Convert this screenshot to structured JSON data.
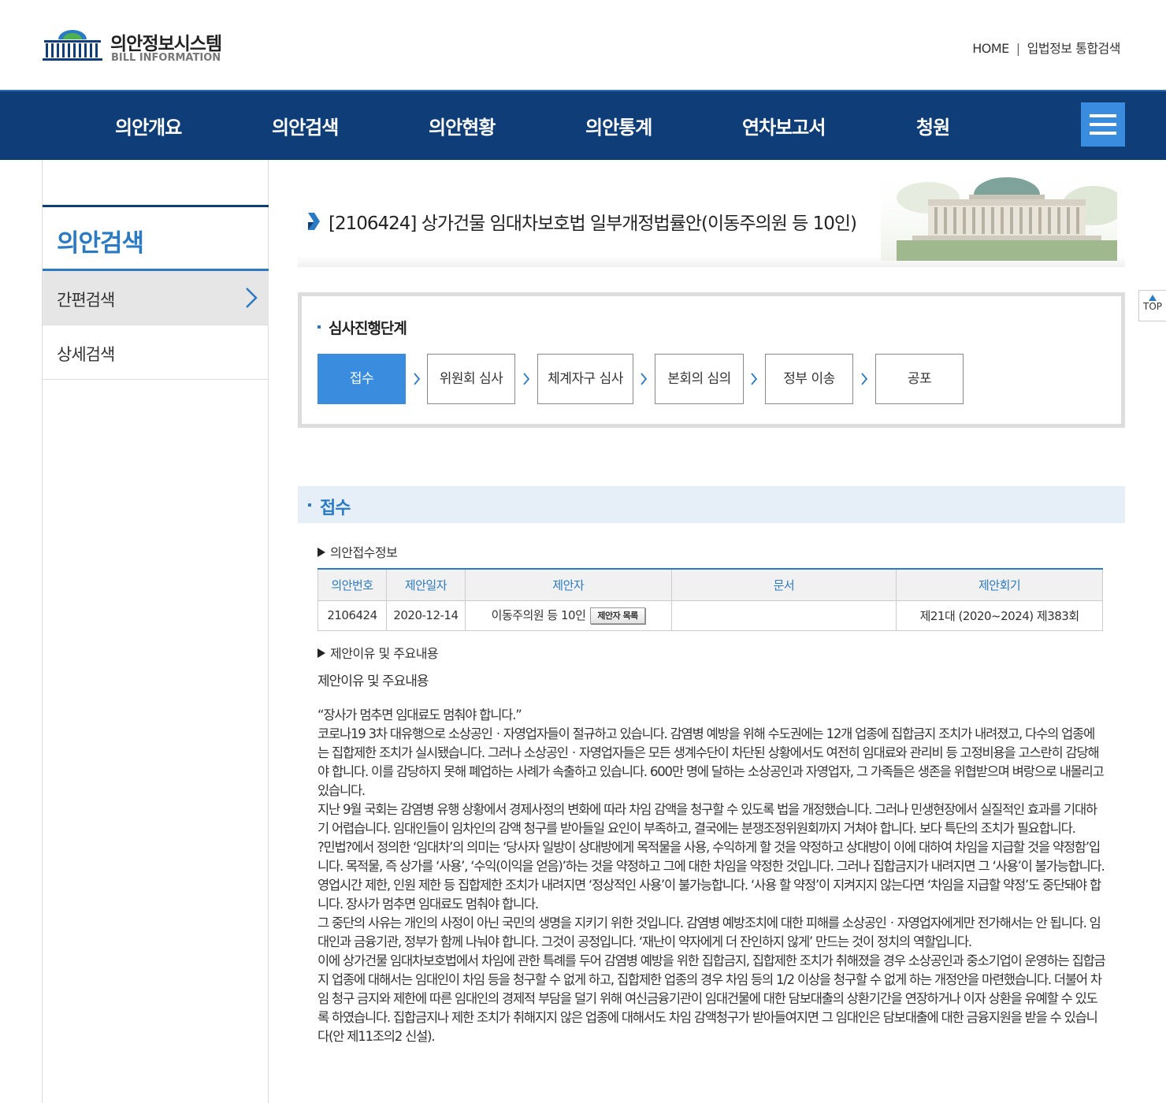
{
  "header": {
    "logo_title": "의안정보시스템",
    "logo_sub": "BILL INFORMATION",
    "util_home": "HOME",
    "util_sep": "|",
    "util_search": "입법정보 통합검색"
  },
  "gnb": [
    "의안개요",
    "의안검색",
    "의안현황",
    "의안통계",
    "연차보고서",
    "청원"
  ],
  "sidebar": {
    "title": "의안검색",
    "items": [
      {
        "label": "간편검색"
      },
      {
        "label": "상세검색"
      }
    ]
  },
  "page": {
    "title": "[2106424] 상가건물 임대차보호법 일부개정법률안(이동주의원 등 10인)",
    "top_label": "TOP"
  },
  "steps": {
    "title": "심사진행단계",
    "items": [
      "접수",
      "위원회 심사",
      "체계자구 심사",
      "본회의 심의",
      "정부 이송",
      "공포"
    ]
  },
  "section": {
    "title": "접수",
    "info_head": "의안접수정보",
    "columns": [
      "의안번호",
      "제안일자",
      "제안자",
      "문서",
      "제안회기"
    ],
    "row": {
      "bill_no": "2106424",
      "date": "2020-12-14",
      "proposer": "이동주의원 등 10인",
      "proposer_btn": "제안자 목록",
      "doc": "",
      "session": "제21대 (2020~2024) 제383회"
    },
    "reason_head": "제안이유 및 주요내용",
    "reason_label": "제안이유 및 주요내용",
    "reason_lines": [
      "“장사가 멈추면 임대료도 멈춰야 합니다.”",
      "코로나19 3차 대유행으로 소상공인ㆍ자영업자들이 절규하고 있습니다. 감염병 예방을 위해 수도권에는 12개 업종에 집합금지 조치가 내려졌고, 다수의 업종에는 집합제한 조치가 실시됐습니다. 그러나 소상공인ㆍ자영업자들은 모든 생계수단이 차단된 상황에서도 여전히 임대료와 관리비 등 고정비용을 고스란히 감당해야 합니다. 이를 감당하지 못해 폐업하는 사례가 속출하고 있습니다. 600만 명에 달하는 소상공인과 자영업자, 그 가족들은 생존을 위협받으며 벼랑으로 내몰리고 있습니다.",
      "지난 9월 국회는 감염병 유행 상황에서 경제사정의 변화에 따라 차임 감액을 청구할 수 있도록 법을 개정했습니다. 그러나 민생현장에서 실질적인 효과를 기대하기 어렵습니다. 임대인들이 임차인의 감액 청구를 받아들일 요인이 부족하고, 결국에는 분쟁조정위원회까지 거쳐야 합니다. 보다 특단의 조치가 필요합니다.",
      "?민법?에서 정의한 ‘임대차’의 의미는 ‘당사자 일방이 상대방에게 목적물을 사용, 수익하게 할 것을 약정하고 상대방이 이에 대하여 차임을 지급할 것을 약정함’입니다. 목적물, 즉 상가를 ‘사용’, ‘수익(이익을 얻음)’하는 것을 약정하고 그에 대한 차임을 약정한 것입니다. 그러나 집합금지가 내려지면 그 ‘사용’이 불가능합니다. 영업시간 제한, 인원 제한 등 집합제한 조치가 내려지면 ‘정상적인 사용’이 불가능합니다. ‘사용 할 약정’이 지켜지지 않는다면 ‘차임을 지급할 약정’도 중단돼야 합니다. 장사가 멈추면 임대료도 멈춰야 합니다.",
      "그 중단의 사유는 개인의 사정이 아닌 국민의 생명을 지키기 위한 것입니다. 감염병 예방조치에 대한 피해를 소상공인ㆍ자영업자에게만 전가해서는 안 됩니다. 임대인과 금융기관, 정부가 함께 나눠야 합니다. 그것이 공정입니다. ‘재난이 약자에게 더 잔인하지 않게’ 만드는 것이 정치의 역할입니다.",
      "이에 상가건물 임대차보호법에서 차임에 관한 특례를 두어 감염병 예방을 위한 집합금지, 집합제한 조치가 취해졌을 경우 소상공인과 중소기업이 운영하는 집합금지 업종에 대해서는 임대인이 차임 등을 청구할 수 없게 하고, 집합제한 업종의 경우 차임 등의 1/2 이상을 청구할 수 없게 하는 개정안을 마련했습니다. 더불어 차임 청구 금지와 제한에 따른 임대인의 경제적 부담을 덜기 위해 여신금융기관이 임대건물에 대한 담보대출의 상환기간을 연장하거나 이자 상환을 유예할 수 있도록 하였습니다. 집합금지나 제한 조치가 취해지지 않은 업종에 대해서도 차임 감액청구가 받아들여지면 그 임대인은 담보대출에 대한 금융지원을 받을 수 있습니다(안 제11조의2 신설)."
    ]
  },
  "colors": {
    "navy": "#0e3d78",
    "accent": "#2a7ac4",
    "button_blue": "#3a8dde"
  },
  "icons": [
    "national-assembly-logo-icon",
    "hamburger-menu-icon",
    "chevron-right-icon",
    "title-arrow-icon",
    "assembly-building-image",
    "top-arrow-icon"
  ]
}
